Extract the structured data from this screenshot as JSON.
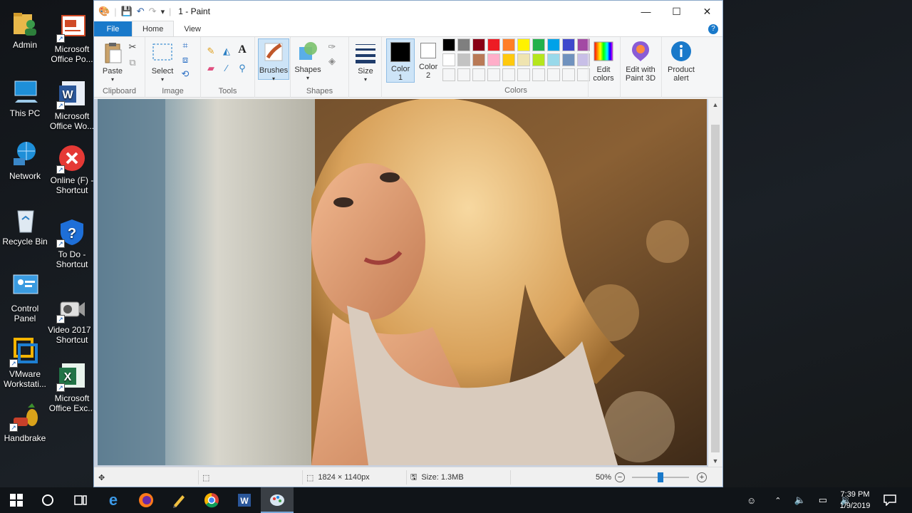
{
  "desktop": {
    "icons": [
      {
        "label": "Admin",
        "icon": "user-folder-icon",
        "shortcut": false
      },
      {
        "label": "This PC",
        "icon": "computer-icon",
        "shortcut": false
      },
      {
        "label": "Network",
        "icon": "network-icon",
        "shortcut": false
      },
      {
        "label": "Recycle Bin",
        "icon": "recycle-bin-icon",
        "shortcut": false
      },
      {
        "label": "Control Panel",
        "icon": "control-panel-icon",
        "shortcut": false
      },
      {
        "label": "VMware Workstati...",
        "icon": "vmware-icon",
        "shortcut": true
      },
      {
        "label": "Handbrake",
        "icon": "handbrake-icon",
        "shortcut": true
      },
      {
        "label": "Microsoft Office Po...",
        "icon": "powerpoint-icon",
        "shortcut": true
      },
      {
        "label": "Microsoft Office Wo...",
        "icon": "word-icon",
        "shortcut": true
      },
      {
        "label": "Online (F) - Shortcut",
        "icon": "error-drive-icon",
        "shortcut": true
      },
      {
        "label": "To Do - Shortcut",
        "icon": "shield-question-icon",
        "shortcut": true
      },
      {
        "label": "Video 2017 - Shortcut",
        "icon": "camcorder-icon",
        "shortcut": true
      },
      {
        "label": "Microsoft Office Exc...",
        "icon": "excel-icon",
        "shortcut": true
      }
    ]
  },
  "window": {
    "title": "1 - Paint",
    "controls": {
      "minimize": "—",
      "maximize": "☐",
      "close": "✕"
    },
    "quick_access": {
      "save": "💾",
      "undo": "↶",
      "redo": "↷",
      "dropdown": "▾"
    }
  },
  "tabs": {
    "file": "File",
    "home": "Home",
    "view": "View",
    "help": "?"
  },
  "ribbon": {
    "clipboard": {
      "label": "Clipboard",
      "paste": "Paste"
    },
    "image": {
      "label": "Image",
      "select": "Select"
    },
    "tools": {
      "label": "Tools"
    },
    "brushes": {
      "label": "Brushes"
    },
    "shapes": {
      "label": "Shapes",
      "shapes_btn": "Shapes"
    },
    "size": {
      "label": "Size"
    },
    "color1": {
      "label": "Color 1",
      "value": "#000000"
    },
    "color2": {
      "label": "Color 2",
      "value": "#ffffff"
    },
    "colors": {
      "label": "Colors",
      "row1": [
        "#000000",
        "#7f7f7f",
        "#880015",
        "#ed1c24",
        "#ff7f27",
        "#fff200",
        "#22b14c",
        "#00a2e8",
        "#3f48cc",
        "#a349a4"
      ],
      "row2": [
        "#ffffff",
        "#c3c3c3",
        "#b97a57",
        "#ffaec9",
        "#ffc90e",
        "#efe4b0",
        "#b5e61d",
        "#99d9ea",
        "#7092be",
        "#c8bfe7"
      ],
      "row3_empty": 10
    },
    "edit_colors": {
      "label": "Edit colors"
    },
    "paint3d": {
      "label": "Edit with Paint 3D"
    },
    "product_alert": {
      "label": "Product alert"
    }
  },
  "status": {
    "dimensions": "1824 × 1140px",
    "size": "Size: 1.3MB",
    "zoom": "50%",
    "zoom_fraction": 0.5
  },
  "taskbar": {
    "time": "7:39 PM",
    "date": "1/9/2019",
    "apps": [
      "windows-start-icon",
      "cortana-icon",
      "task-view-icon",
      "edge-icon",
      "firefox-icon",
      "pencil-app-icon",
      "chrome-icon",
      "word-icon",
      "paint-icon"
    ]
  }
}
